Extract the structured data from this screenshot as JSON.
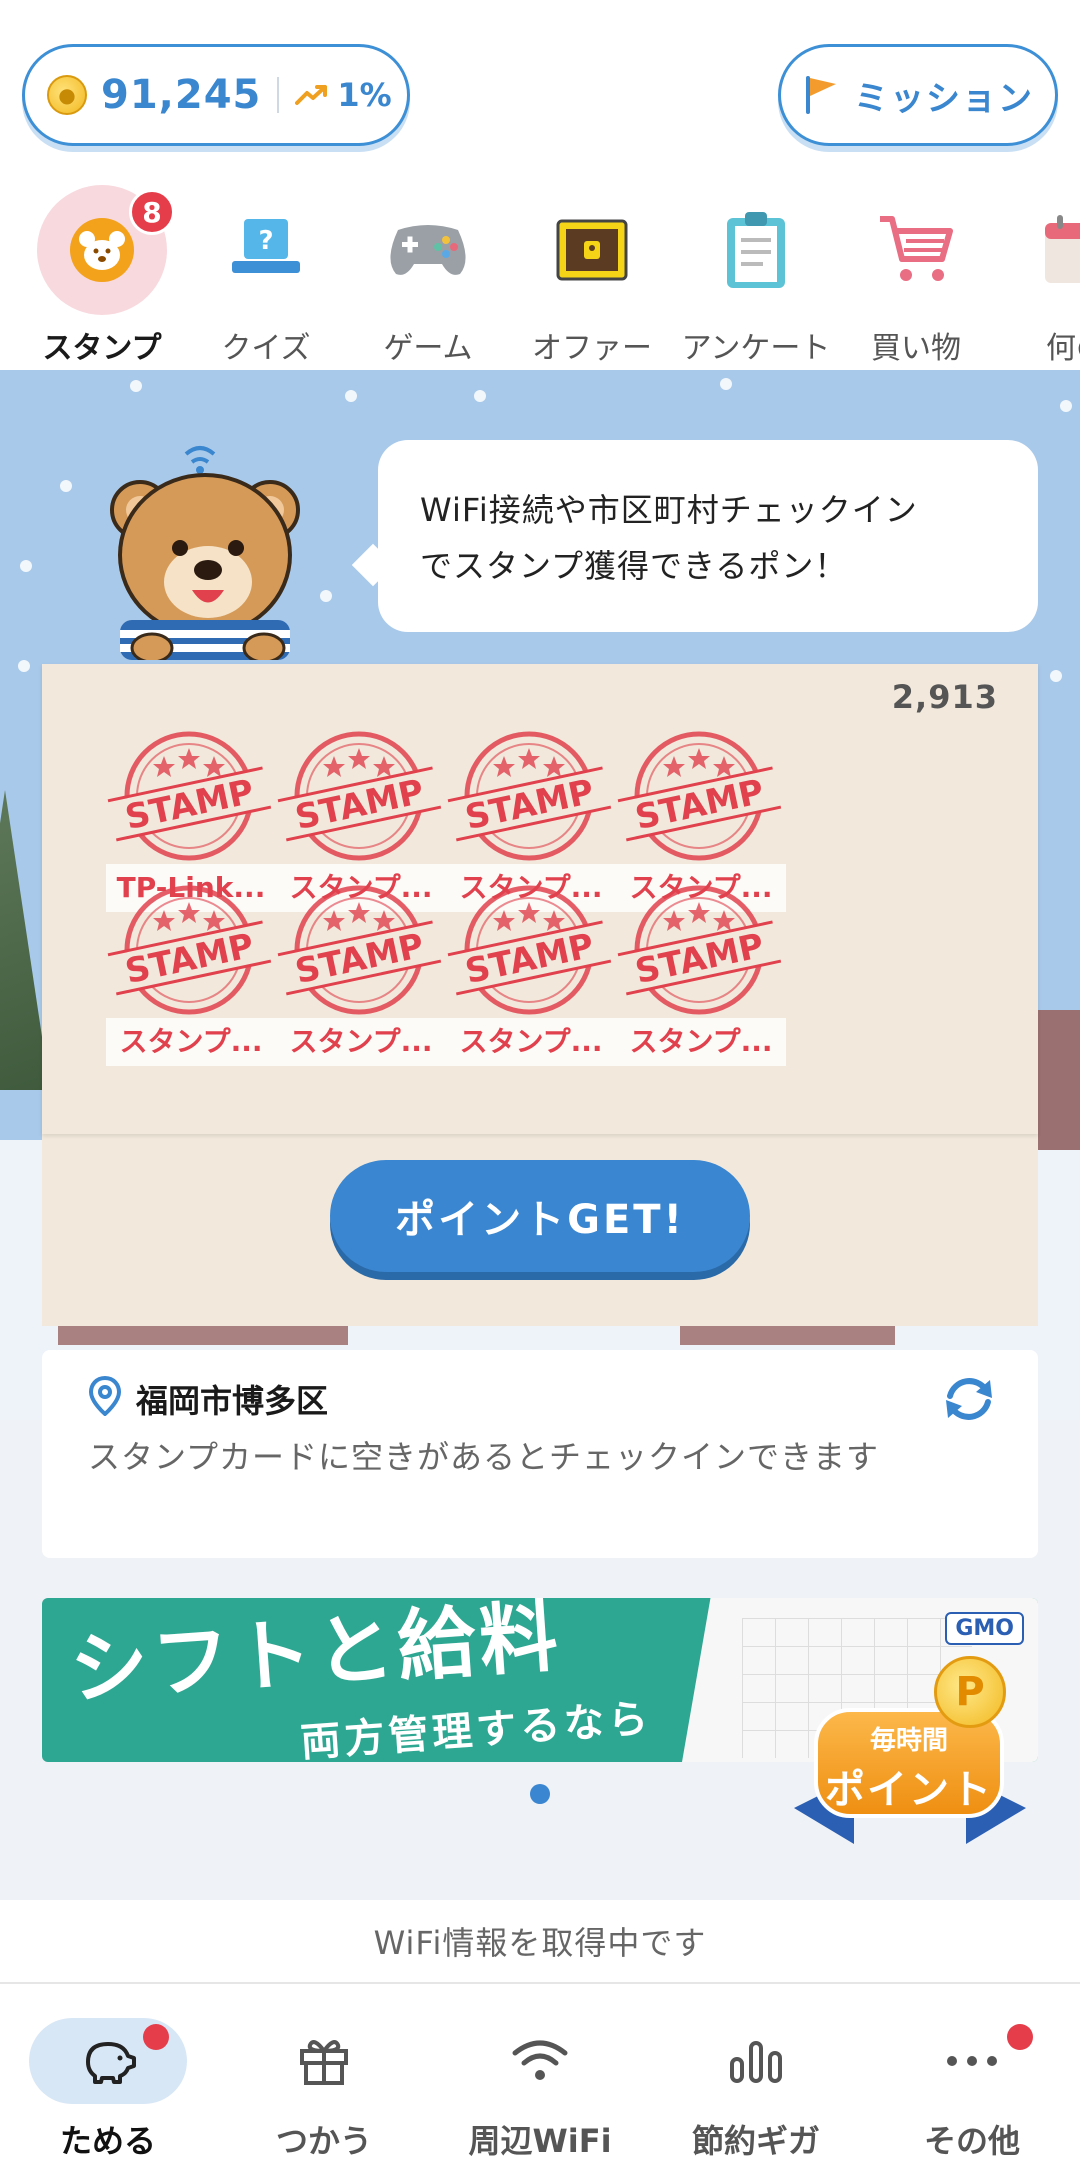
{
  "header": {
    "points": "91,245",
    "trend": "1%",
    "mission_label": "ミッション"
  },
  "tabs": [
    {
      "label": "スタンプ",
      "icon": "bear-icon",
      "badge": "8",
      "active": true
    },
    {
      "label": "クイズ",
      "icon": "quiz-icon"
    },
    {
      "label": "ゲーム",
      "icon": "gamepad-icon"
    },
    {
      "label": "オファー",
      "icon": "treasure-icon"
    },
    {
      "label": "アンケート",
      "icon": "clipboard-icon"
    },
    {
      "label": "買い物",
      "icon": "cart-icon"
    },
    {
      "label": "何の",
      "icon": "calendar-icon"
    }
  ],
  "stamp_section": {
    "speech": "WiFi接続や市区町村チェックインでスタンプ獲得できるポン！",
    "speech_line1": "WiFi接続や市区町村チェックイン",
    "speech_line2": "でスタンプ獲得できるポン！",
    "count": "2,913",
    "stamp_word": "STAMP",
    "stamps": [
      {
        "label": "TP-Link..."
      },
      {
        "label": "スタンプ..."
      },
      {
        "label": "スタンプ..."
      },
      {
        "label": "スタンプ..."
      },
      {
        "label": "スタンプ..."
      },
      {
        "label": "スタンプ..."
      },
      {
        "label": "スタンプ..."
      },
      {
        "label": "スタンプ..."
      }
    ],
    "get_button": "ポイントGET!"
  },
  "location": {
    "name": "福岡市博多区",
    "note": "スタンプカードに空きがあるとチェックインできます"
  },
  "banner": {
    "title": "シフトと給料",
    "subtitle": "両方管理するなら",
    "brand": "GMO",
    "badge_line1": "毎時間",
    "badge_line2": "ポイント",
    "coin_letter": "P"
  },
  "status": "WiFi情報を取得中です",
  "bottom_nav": [
    {
      "label": "ためる",
      "icon": "piggy-bank-icon",
      "active": true,
      "dot": true
    },
    {
      "label": "つかう",
      "icon": "gift-icon"
    },
    {
      "label": "周辺WiFi",
      "icon": "wifi-icon"
    },
    {
      "label": "節約ギガ",
      "icon": "bar-chart-icon"
    },
    {
      "label": "その他",
      "icon": "more-icon",
      "dot": true
    }
  ],
  "colors": {
    "accent": "#3b86d0",
    "badge_red": "#e53d4a",
    "stamp_red": "#e0414d",
    "card_beige": "#f2e9dc",
    "sky": "#a9c9ea",
    "banner_teal": "#2ea792"
  }
}
